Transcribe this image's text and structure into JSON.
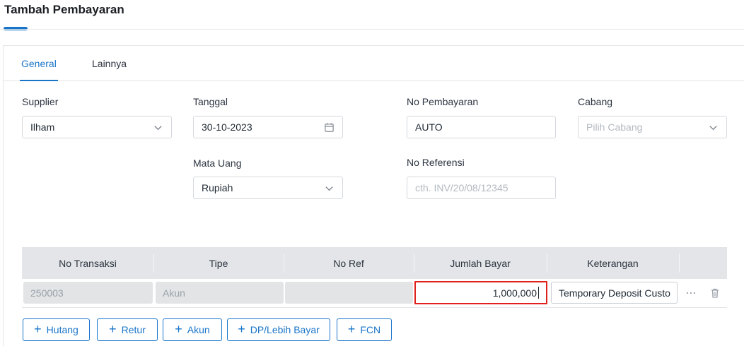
{
  "page": {
    "title": "Tambah Pembayaran"
  },
  "tabs": [
    {
      "label": "General",
      "active": true
    },
    {
      "label": "Lainnya",
      "active": false
    }
  ],
  "form": {
    "supplier": {
      "label": "Supplier",
      "value": "Ilham"
    },
    "tanggal": {
      "label": "Tanggal",
      "value": "30-10-2023"
    },
    "no_pembayaran": {
      "label": "No Pembayaran",
      "value": "AUTO"
    },
    "cabang": {
      "label": "Cabang",
      "placeholder": "Pilih Cabang"
    },
    "mata_uang": {
      "label": "Mata Uang",
      "value": "Rupiah"
    },
    "no_referensi": {
      "label": "No Referensi",
      "placeholder": "cth. INV/20/08/12345"
    }
  },
  "table": {
    "columns": [
      "No Transaksi",
      "Tipe",
      "No Ref",
      "Jumlah Bayar",
      "Keterangan"
    ],
    "rows": [
      {
        "no_transaksi": "250003",
        "tipe": "Akun",
        "no_ref": "",
        "jumlah_bayar": "1,000,000",
        "keterangan": "Temporary Deposit Custo"
      }
    ]
  },
  "actions": [
    {
      "label": "Hutang",
      "icon": "plus-icon"
    },
    {
      "label": "Retur",
      "icon": "plus-icon"
    },
    {
      "label": "Akun",
      "icon": "plus-icon"
    },
    {
      "label": "DP/Lebih Bayar",
      "icon": "plus-icon"
    },
    {
      "label": "FCN",
      "icon": "plus-icon"
    }
  ],
  "colors": {
    "accent": "#1a75c9",
    "highlight": "#e0201c",
    "header_bg": "#e3e5e8"
  }
}
